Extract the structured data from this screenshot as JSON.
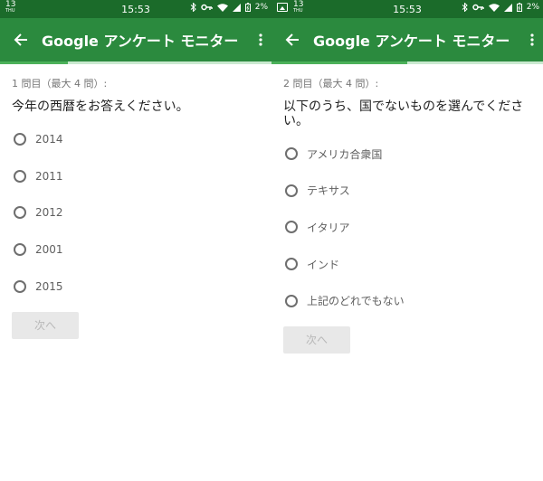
{
  "status_bar": {
    "date_day": "13",
    "date_weekday": "THU",
    "time": "15:53",
    "battery": "2%"
  },
  "app": {
    "title": "Google アンケート モニター"
  },
  "colors": {
    "status_bar": "#1b6b2a",
    "toolbar": "#2b8a3e",
    "progress_fill": "#4cb15a",
    "progress_track": "#c9e9cf"
  },
  "screens": [
    {
      "progress_fraction": 0.25,
      "question_number": "1 問目（最大 4 問）:",
      "question_text": "今年の西暦をお答えください。",
      "options": [
        "2014",
        "2011",
        "2012",
        "2001",
        "2015"
      ],
      "next_button": "次へ"
    },
    {
      "progress_fraction": 0.5,
      "question_number": "2 問目（最大 4 問）:",
      "question_text": "以下のうち、国でないものを選んでください。",
      "options": [
        "アメリカ合衆国",
        "テキサス",
        "イタリア",
        "インド",
        "上記のどれでもない"
      ],
      "next_button": "次へ"
    }
  ]
}
